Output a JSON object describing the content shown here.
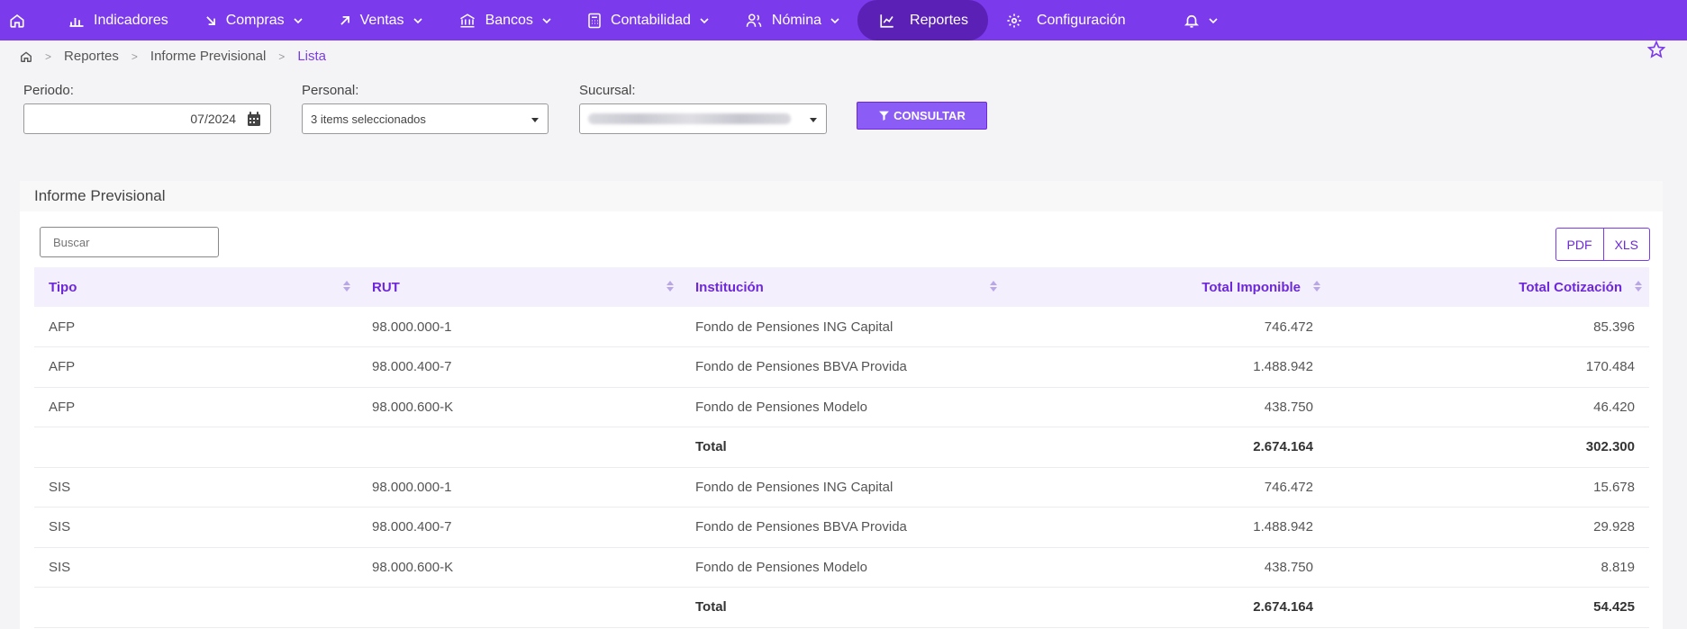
{
  "nav": {
    "items": [
      {
        "label": "Indicadores",
        "icon": "bar-chart-icon",
        "dropdown": false
      },
      {
        "label": "Compras",
        "icon": "arrow-down-right-icon",
        "dropdown": true
      },
      {
        "label": "Ventas",
        "icon": "arrow-up-right-icon",
        "dropdown": true
      },
      {
        "label": "Bancos",
        "icon": "bank-icon",
        "dropdown": true
      },
      {
        "label": "Contabilidad",
        "icon": "calculator-icon",
        "dropdown": true
      },
      {
        "label": "Nómina",
        "icon": "users-icon",
        "dropdown": true
      },
      {
        "label": "Reportes",
        "icon": "line-chart-icon",
        "dropdown": false,
        "active": true
      },
      {
        "label": "Configuración",
        "icon": "gear-icon",
        "dropdown": false
      }
    ],
    "accent": "#7c3aed"
  },
  "breadcrumb": {
    "items": [
      "Reportes",
      "Informe Previsional"
    ],
    "current": "Lista"
  },
  "filters": {
    "periodo_label": "Periodo:",
    "periodo_value": "07/2024",
    "personal_label": "Personal:",
    "personal_value": "3 items seleccionados",
    "sucursal_label": "Sucursal:",
    "consultar_label": "CONSULTAR"
  },
  "panel": {
    "title": "Informe Previsional",
    "search_placeholder": "Buscar",
    "pdf_label": "PDF",
    "xls_label": "XLS"
  },
  "table": {
    "columns": [
      "Tipo",
      "RUT",
      "Institución",
      "Total Imponible",
      "Total Cotización"
    ],
    "rows": [
      {
        "tipo": "AFP",
        "rut": "98.000.000-1",
        "inst": "Fondo de Pensiones ING Capital",
        "imponible": "746.472",
        "cotizacion": "85.396"
      },
      {
        "tipo": "AFP",
        "rut": "98.000.400-7",
        "inst": "Fondo de Pensiones BBVA Provida",
        "imponible": "1.488.942",
        "cotizacion": "170.484"
      },
      {
        "tipo": "AFP",
        "rut": "98.000.600-K",
        "inst": "Fondo de Pensiones Modelo",
        "imponible": "438.750",
        "cotizacion": "46.420"
      },
      {
        "tipo": "",
        "rut": "",
        "inst": "Total",
        "imponible": "2.674.164",
        "cotizacion": "302.300",
        "total": true
      },
      {
        "tipo": "SIS",
        "rut": "98.000.000-1",
        "inst": "Fondo de Pensiones ING Capital",
        "imponible": "746.472",
        "cotizacion": "15.678"
      },
      {
        "tipo": "SIS",
        "rut": "98.000.400-7",
        "inst": "Fondo de Pensiones BBVA Provida",
        "imponible": "1.488.942",
        "cotizacion": "29.928"
      },
      {
        "tipo": "SIS",
        "rut": "98.000.600-K",
        "inst": "Fondo de Pensiones Modelo",
        "imponible": "438.750",
        "cotizacion": "8.819"
      },
      {
        "tipo": "",
        "rut": "",
        "inst": "Total",
        "imponible": "2.674.164",
        "cotizacion": "54.425",
        "total": true
      }
    ]
  }
}
